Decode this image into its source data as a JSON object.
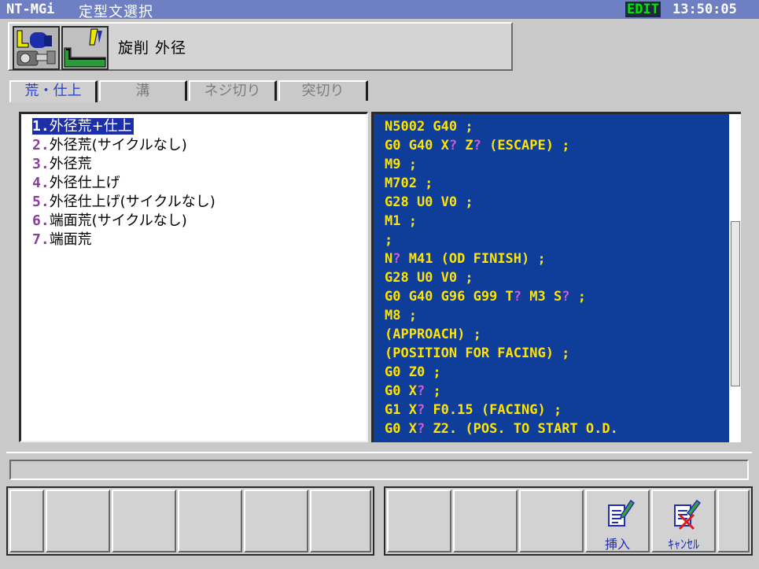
{
  "titlebar": {
    "app_name": "NT-MGi",
    "screen_title": "定型文選択",
    "mode": "EDIT",
    "time": "13:50:05"
  },
  "header": {
    "process_label": "旋削 外径",
    "icons": [
      "lathe-operation-icon",
      "od-turning-tool-icon"
    ]
  },
  "tabs": [
    {
      "label": "荒・仕上",
      "active": true
    },
    {
      "label": "溝",
      "active": false
    },
    {
      "label": "ネジ切り",
      "active": false
    },
    {
      "label": "突切り",
      "active": false
    }
  ],
  "template_list": [
    {
      "num": "1.",
      "label": "外径荒+仕上",
      "selected": true
    },
    {
      "num": "2.",
      "label": "外径荒(サイクルなし)",
      "selected": false
    },
    {
      "num": "3.",
      "label": "外径荒",
      "selected": false
    },
    {
      "num": "4.",
      "label": "外径仕上げ",
      "selected": false
    },
    {
      "num": "5.",
      "label": "外径仕上げ(サイクルなし)",
      "selected": false
    },
    {
      "num": "6.",
      "label": "端面荒(サイクルなし)",
      "selected": false
    },
    {
      "num": "7.",
      "label": "端面荒",
      "selected": false
    }
  ],
  "code_lines": [
    "N5002 G40 ;",
    "G0 G40 X? Z? (ESCAPE) ;",
    "M9 ;",
    "M702 ;",
    "G28 U0 V0 ;",
    "M1 ;",
    ";",
    "N? M41 (OD FINISH) ;",
    "G28 U0 V0 ;",
    "G0 G40 G96 G99 T? M3 S? ;",
    "M8 ;",
    "(APPROACH) ;",
    "(POSITION FOR FACING) ;",
    "G0 Z0 ;",
    "G0 X? ;",
    "G1 X? F0.15 (FACING) ;",
    "G0 X? Z2. (POS. TO START O.D."
  ],
  "message": "",
  "function_keys": {
    "left": [
      "",
      "",
      "",
      "",
      "",
      ""
    ],
    "right": [
      {
        "label": ""
      },
      {
        "label": ""
      },
      {
        "label": ""
      },
      {
        "label": "挿入",
        "icon": "insert-document-icon"
      },
      {
        "label": "ｷｬﾝｾﾙ",
        "icon": "cancel-document-icon"
      },
      {
        "label": ""
      }
    ]
  },
  "colors": {
    "title_bar": "#6f7fc4",
    "code_background": "#0e3d9a",
    "code_text": "#ffe400",
    "placeholder_mark": "#d15bd0",
    "selection": "#1c2fa8",
    "mode_text": "#00e800"
  }
}
